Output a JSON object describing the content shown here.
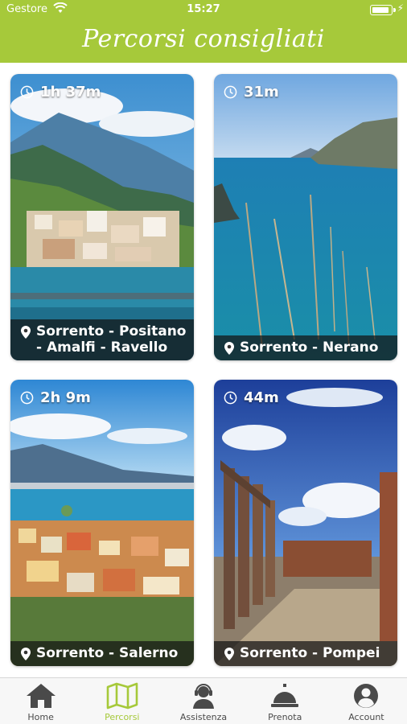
{
  "status_bar": {
    "carrier": "Gestore",
    "time": "15:27",
    "battery_level": 0.92
  },
  "header": {
    "title": "Percorsi consigliati"
  },
  "routes": [
    {
      "duration": "1h 37m",
      "route": "Sorrento - Positano\n- Amalfi - Ravello"
    },
    {
      "duration": "31m",
      "route": "Sorrento - Nerano"
    },
    {
      "duration": "2h 9m",
      "route": "Sorrento - Salerno"
    },
    {
      "duration": "44m",
      "route": "Sorrento - Pompei"
    }
  ],
  "tabs": [
    {
      "label": "Home",
      "icon": "home-icon",
      "active": false
    },
    {
      "label": "Percorsi",
      "icon": "map-icon",
      "active": true
    },
    {
      "label": "Assistenza",
      "icon": "support-agent-icon",
      "active": false
    },
    {
      "label": "Prenota",
      "icon": "service-bell-icon",
      "active": false
    },
    {
      "label": "Account",
      "icon": "account-icon",
      "active": false
    }
  ],
  "colors": {
    "accent": "#a6c93a",
    "tab_inactive": "#4a4a4a",
    "route_bar": "#141414"
  }
}
